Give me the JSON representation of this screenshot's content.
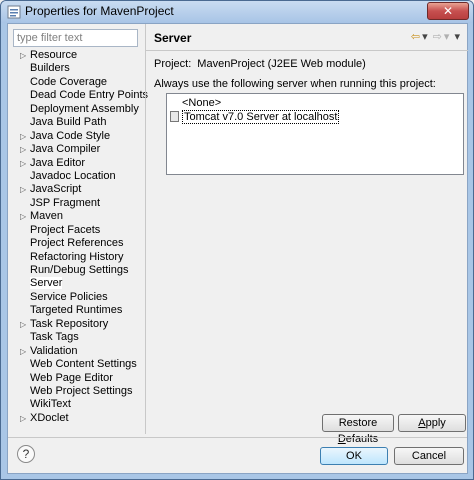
{
  "window": {
    "title": "Properties for MavenProject",
    "close_label": "✕"
  },
  "filter": {
    "placeholder": "type filter text"
  },
  "nav": {
    "items": [
      {
        "label": "Resource",
        "expandable": true
      },
      {
        "label": "Builders",
        "expandable": false
      },
      {
        "label": "Code Coverage",
        "expandable": false
      },
      {
        "label": "Dead Code Entry Points",
        "expandable": false
      },
      {
        "label": "Deployment Assembly",
        "expandable": false
      },
      {
        "label": "Java Build Path",
        "expandable": false
      },
      {
        "label": "Java Code Style",
        "expandable": true
      },
      {
        "label": "Java Compiler",
        "expandable": true
      },
      {
        "label": "Java Editor",
        "expandable": true
      },
      {
        "label": "Javadoc Location",
        "expandable": false
      },
      {
        "label": "JavaScript",
        "expandable": true
      },
      {
        "label": "JSP Fragment",
        "expandable": false
      },
      {
        "label": "Maven",
        "expandable": true
      },
      {
        "label": "Project Facets",
        "expandable": false
      },
      {
        "label": "Project References",
        "expandable": false
      },
      {
        "label": "Refactoring History",
        "expandable": false
      },
      {
        "label": "Run/Debug Settings",
        "expandable": false
      },
      {
        "label": "Server",
        "expandable": false,
        "selected": true
      },
      {
        "label": "Service Policies",
        "expandable": false
      },
      {
        "label": "Targeted Runtimes",
        "expandable": false
      },
      {
        "label": "Task Repository",
        "expandable": true
      },
      {
        "label": "Task Tags",
        "expandable": false
      },
      {
        "label": "Validation",
        "expandable": true
      },
      {
        "label": "Web Content Settings",
        "expandable": false
      },
      {
        "label": "Web Page Editor",
        "expandable": false
      },
      {
        "label": "Web Project Settings",
        "expandable": false
      },
      {
        "label": "WikiText",
        "expandable": false
      },
      {
        "label": "XDoclet",
        "expandable": true
      }
    ]
  },
  "page": {
    "title": "Server",
    "project_label": "Project:",
    "project_value": "MavenProject (J2EE Web module)",
    "instruction": "Always use the following server when running this project:",
    "servers": [
      "<None>",
      "Tomcat v7.0 Server at localhost"
    ]
  },
  "buttons": {
    "restore_prefix": "Restore ",
    "restore_mnemonic": "D",
    "restore_suffix": "efaults",
    "apply_mnemonic": "A",
    "apply_suffix": "pply",
    "ok": "OK",
    "cancel": "Cancel"
  },
  "icons": {
    "back": "back-arrow-icon",
    "forward": "forward-arrow-icon",
    "menu": "view-menu-icon",
    "help": "help-icon"
  }
}
